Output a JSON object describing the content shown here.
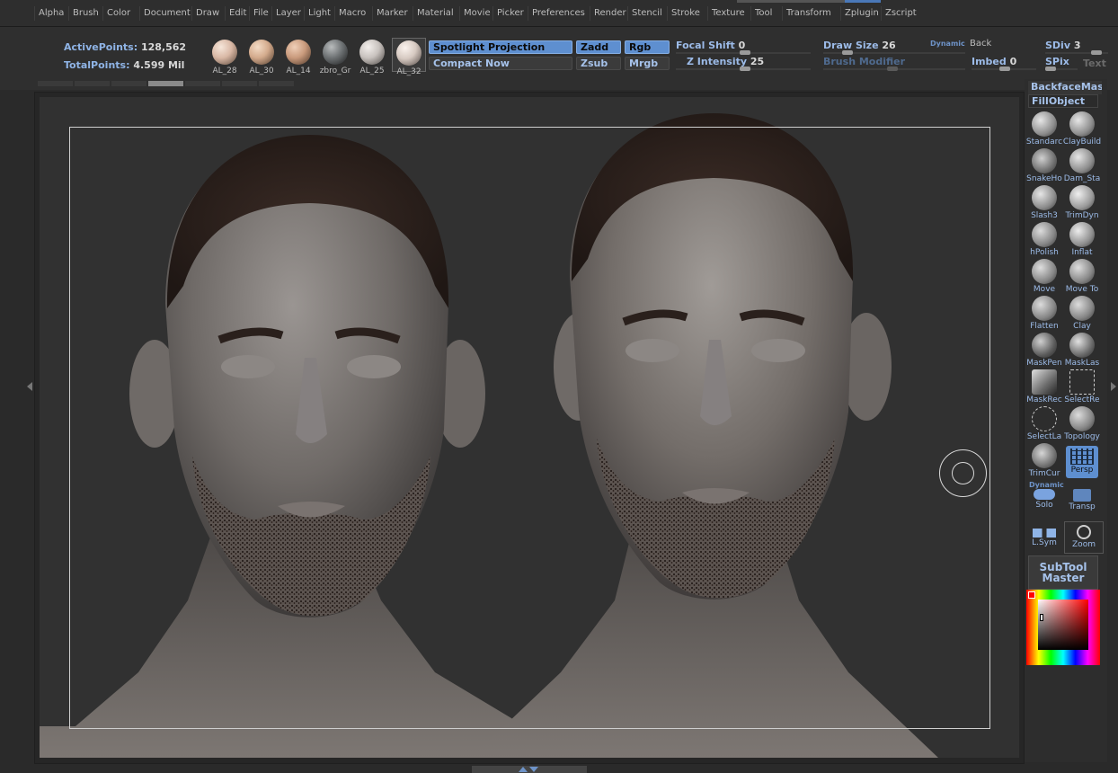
{
  "menu": [
    "Alpha",
    "Brush",
    "Color",
    "Document",
    "Draw",
    "Edit",
    "File",
    "Layer",
    "Light",
    "Macro",
    "Marker",
    "Material",
    "Movie",
    "Picker",
    "Preferences",
    "Render",
    "Stencil",
    "Stroke",
    "Texture",
    "Tool",
    "Transform",
    "Zplugin",
    "Zscript"
  ],
  "stats": {
    "active_points_label": "ActivePoints:",
    "active_points_value": "128,562",
    "total_points_label": "TotalPoints:",
    "total_points_value": "4.599 Mil"
  },
  "materials": [
    {
      "label": "AL_28",
      "color": "#d9b8a5"
    },
    {
      "label": "AL_30",
      "color": "#d3aa8c"
    },
    {
      "label": "AL_14",
      "color": "#c99a7c"
    },
    {
      "label": "zbro_Gr",
      "color": "#6e7274"
    },
    {
      "label": "AL_25",
      "color": "#c8c2be"
    },
    {
      "label": "AL_32",
      "color": "#d6c9c1"
    }
  ],
  "projection": {
    "spotlight": "Spotlight Projection",
    "compact": "Compact Now"
  },
  "modes": {
    "zadd": "Zadd",
    "zsub": "Zsub",
    "rgb": "Rgb",
    "mrgb": "Mrgb"
  },
  "sliders": {
    "focal_shift_label": "Focal Shift",
    "focal_shift_value": "0",
    "z_intensity_label": "Z Intensity",
    "z_intensity_value": "25",
    "draw_size_label": "Draw Size",
    "draw_size_value": "26",
    "dynamic": "Dynamic",
    "brush_modifier_label": "Brush Modifier",
    "back_label": "Back",
    "imbed_label": "Imbed",
    "imbed_value": "0",
    "sdiv_label": "SDiv",
    "sdiv_value": "3",
    "spix_label": "SPix",
    "texture_label": "Text"
  },
  "right_shelf": {
    "backface_mask": "BackfaceMasl",
    "fill_object": "FillObject",
    "brushes": [
      {
        "label": "Standarc",
        "icon": "standard-brush-icon"
      },
      {
        "label": "ClayBuild",
        "icon": "claybuildup-brush-icon"
      },
      {
        "label": "SnakeHo",
        "icon": "snakehook-brush-icon"
      },
      {
        "label": "Dam_Sta",
        "icon": "damstandard-brush-icon"
      },
      {
        "label": "Slash3",
        "icon": "slash3-brush-icon"
      },
      {
        "label": "TrimDyn",
        "icon": "trimdynamic-brush-icon"
      },
      {
        "label": "hPolish",
        "icon": "hpolish-brush-icon"
      },
      {
        "label": "Inflat",
        "icon": "inflate-brush-icon"
      },
      {
        "label": "Move",
        "icon": "move-brush-icon"
      },
      {
        "label": "Move To",
        "icon": "move-topological-brush-icon"
      },
      {
        "label": "Flatten",
        "icon": "flatten-brush-icon"
      },
      {
        "label": "Clay",
        "icon": "clay-brush-icon"
      },
      {
        "label": "MaskPen",
        "icon": "maskpen-brush-icon"
      },
      {
        "label": "MaskLas",
        "icon": "masklasso-brush-icon"
      },
      {
        "label": "MaskRec",
        "icon": "maskrect-brush-icon"
      },
      {
        "label": "SelectRe",
        "icon": "selectrect-brush-icon"
      },
      {
        "label": "SelectLa",
        "icon": "selectlasso-brush-icon"
      },
      {
        "label": "Topology",
        "icon": "topology-brush-icon"
      },
      {
        "label": "TrimCur",
        "icon": "trimcurve-brush-icon"
      },
      {
        "label": "Persp",
        "icon": "perspective-icon"
      }
    ],
    "dynamic_label": "Dynamic",
    "solo": "Solo",
    "transp": "Transp",
    "lsym": "L.Sym",
    "zoom": "Zoom",
    "subtool_master_line1": "SubTool",
    "subtool_master_line2": "Master"
  },
  "colors": {
    "accent": "#5e8fd0",
    "label_blue": "#9cbbe8",
    "background": "#2a2a2a",
    "viewport": "#313131"
  }
}
